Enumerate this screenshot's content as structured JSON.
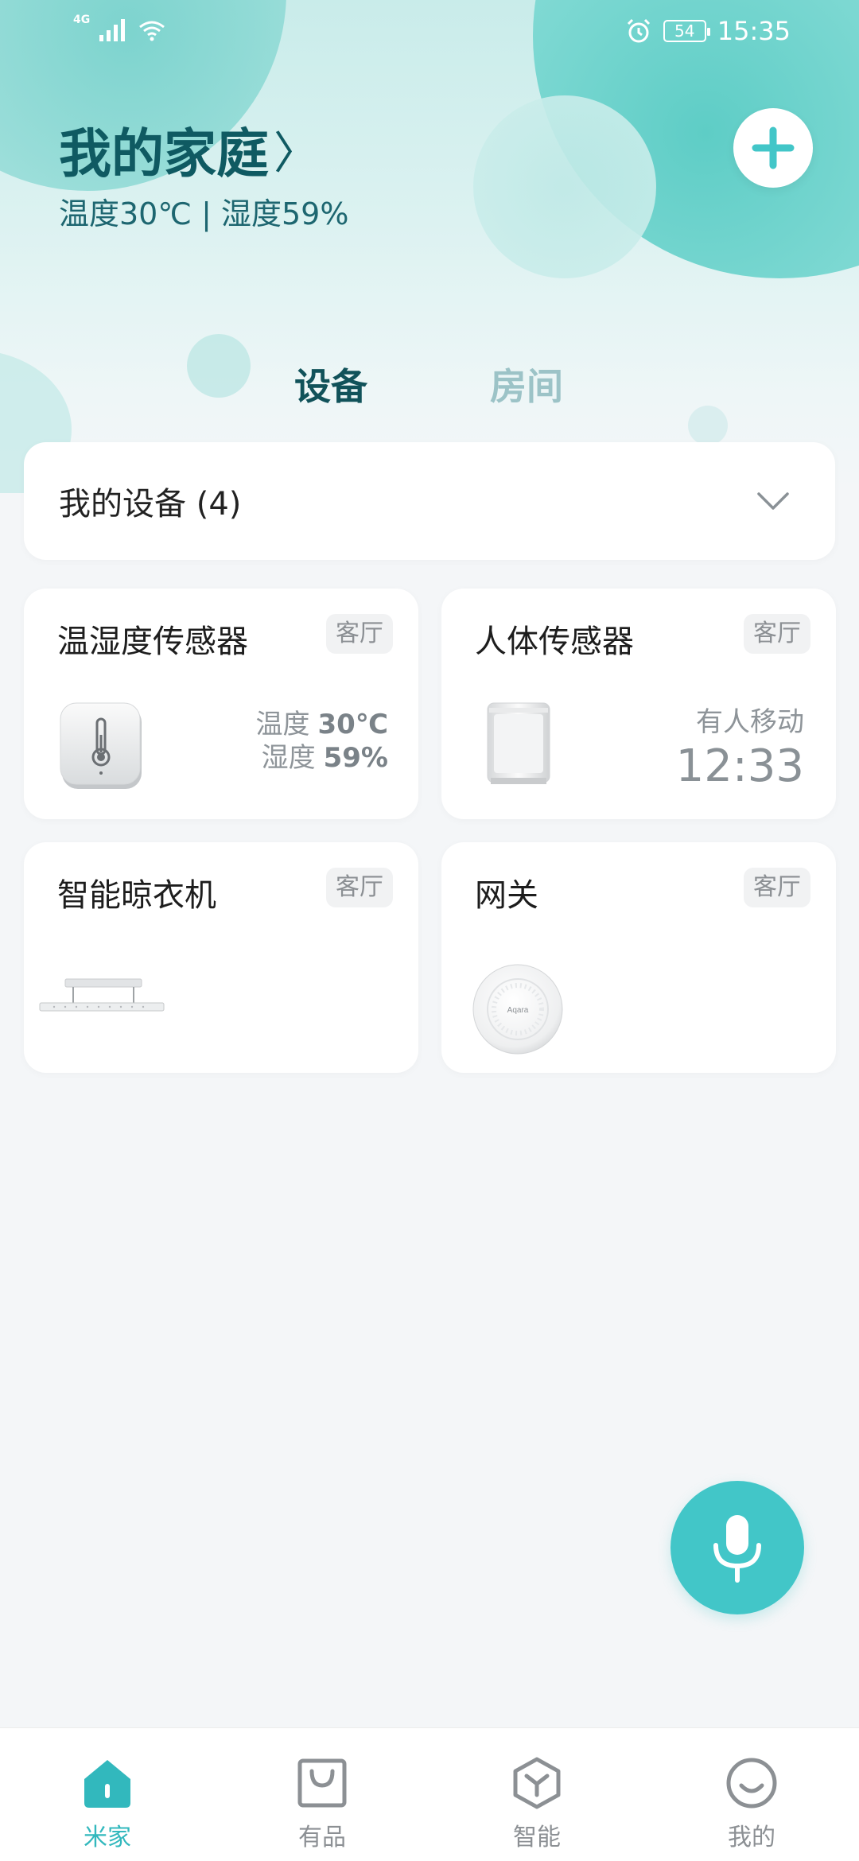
{
  "status_bar": {
    "network": "4G",
    "battery": "54",
    "time": "15:35"
  },
  "header": {
    "title": "我的家庭",
    "chevron": "〉",
    "climate": "温度30℃ | 湿度59%"
  },
  "tabs": [
    {
      "label": "设备",
      "active": true
    },
    {
      "label": "房间",
      "active": false
    }
  ],
  "device_group": {
    "title": "我的设备 (4)"
  },
  "devices": [
    {
      "name": "温湿度传感器",
      "room": "客厅",
      "icon": "thermometer-sensor-icon",
      "temp_label": "温度",
      "temp_value": "30℃",
      "humidity_label": "湿度",
      "humidity_value": "59%"
    },
    {
      "name": "人体传感器",
      "room": "客厅",
      "icon": "motion-sensor-icon",
      "status": "有人移动",
      "time": "12:33"
    },
    {
      "name": "智能晾衣机",
      "room": "客厅",
      "icon": "clothes-dryer-icon"
    },
    {
      "name": "网关",
      "room": "客厅",
      "icon": "gateway-icon",
      "brand_text": "Aqara"
    }
  ],
  "bottom_nav": [
    {
      "label": "米家",
      "icon": "home-icon",
      "active": true
    },
    {
      "label": "有品",
      "icon": "shopping-bag-icon",
      "active": false
    },
    {
      "label": "智能",
      "icon": "smart-cube-icon",
      "active": false
    },
    {
      "label": "我的",
      "icon": "smiley-profile-icon",
      "active": false
    }
  ],
  "colors": {
    "accent": "#42c6c8",
    "title": "#0f5a62",
    "background": "#f4f6f8"
  }
}
